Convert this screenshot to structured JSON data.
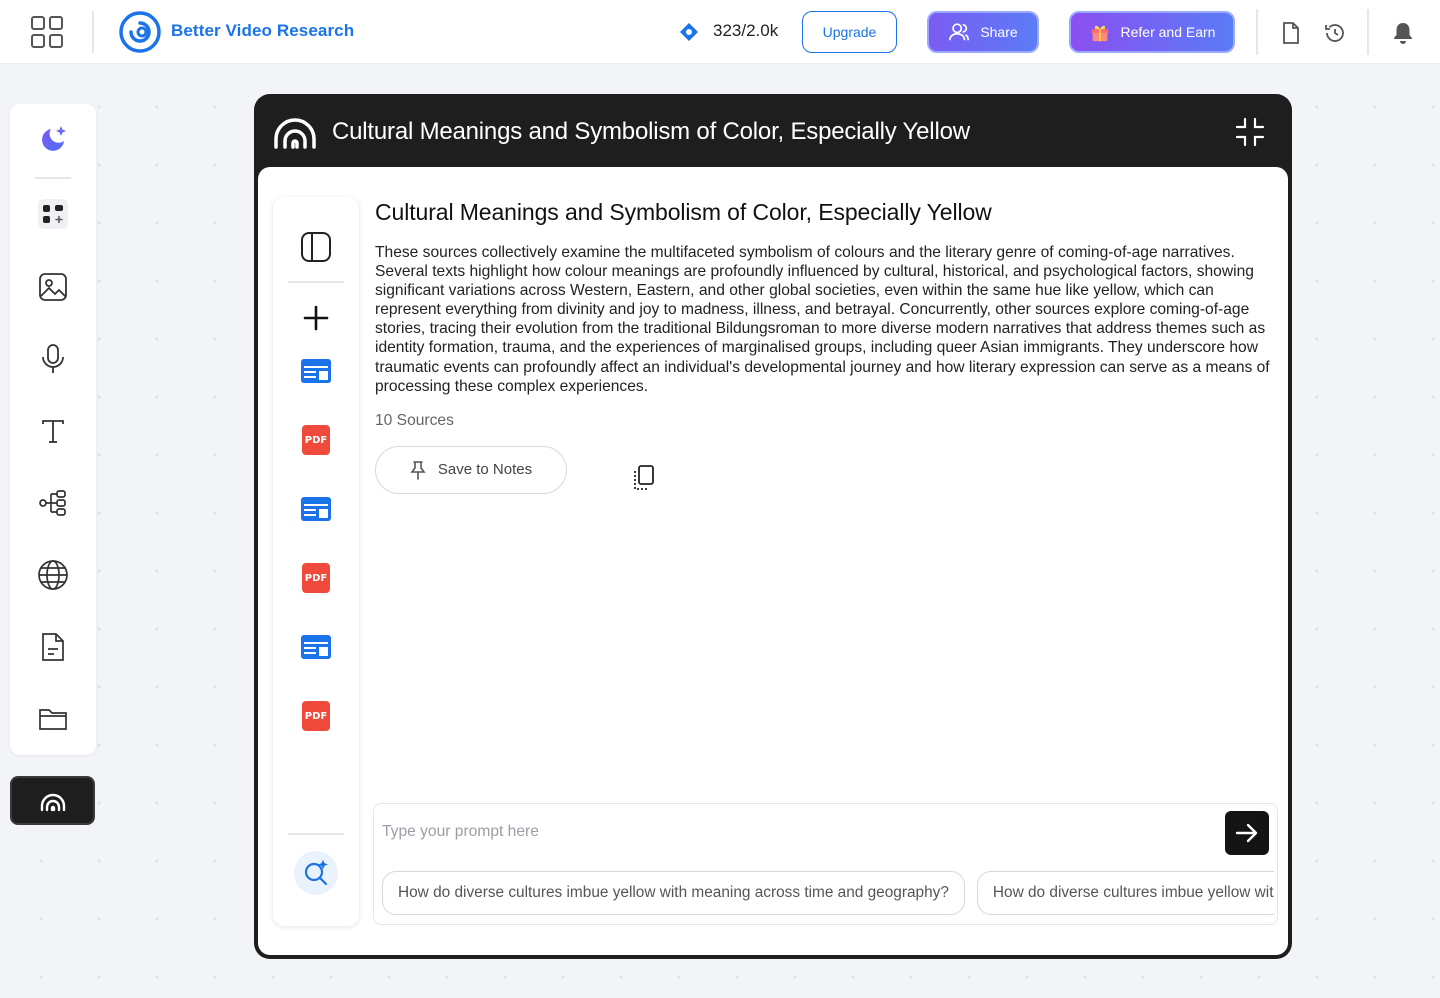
{
  "app": {
    "brand_name": "Better Video Research",
    "accent_color": "#1a73e8"
  },
  "topbar": {
    "credits": "323/2.0k",
    "upgrade_label": "Upgrade",
    "share_label": "Share",
    "refer_label": "Refer and Earn",
    "icons": [
      "apps-grid-icon",
      "brand-logo-icon",
      "credit-diamond-icon",
      "user-share-icon",
      "gift-icon",
      "document-icon",
      "history-icon",
      "bell-icon"
    ]
  },
  "sidebar": {
    "items": [
      "ai-assistant-icon",
      "social-apps-icon",
      "image-icon",
      "microphone-icon",
      "text-icon",
      "mindmap-icon",
      "globe-icon",
      "document-icon",
      "folder-icon"
    ],
    "active_item": "podcast-icon"
  },
  "panel": {
    "title": "Cultural Meanings and Symbolism of Color, Especially Yellow"
  },
  "sources_rail": {
    "items": [
      "web",
      "pdf",
      "web",
      "pdf",
      "web",
      "pdf"
    ],
    "pdf_label": "PDF"
  },
  "summary": {
    "title": "Cultural Meanings and Symbolism of Color, Especially Yellow",
    "text": "These sources collectively examine the multifaceted symbolism of colours and the literary genre of coming-of-age narratives. Several texts highlight how colour meanings are profoundly influenced by cultural, historical, and psychological factors, showing significant variations across Western, Eastern, and other global societies, even within the same hue like yellow, which can represent everything from divinity and joy to madness, illness, and betrayal. Concurrently, other sources explore coming-of-age stories, tracing their evolution from the traditional Bildungsroman to more diverse modern narratives that address themes such as identity formation, trauma, and the experiences of marginalised groups, including queer Asian immigrants. They underscore how traumatic events can profoundly affect an individual's developmental journey and how literary expression can serve as a means of processing these complex experiences.",
    "sources_count": "10 Sources",
    "save_label": "Save to Notes"
  },
  "prompt": {
    "placeholder": "Type your prompt here",
    "value": "",
    "suggestions": [
      "How do diverse cultures imbue yellow with meaning across time and geography?",
      "How do diverse cultures imbue yellow with meaning across time and geography?"
    ]
  }
}
